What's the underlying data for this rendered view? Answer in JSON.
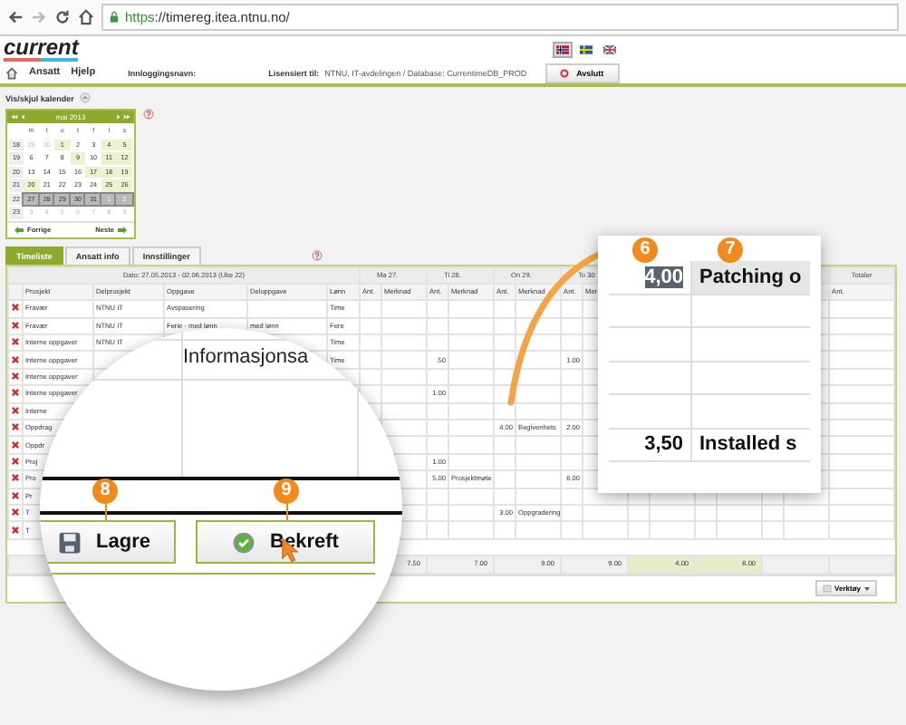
{
  "browser": {
    "url_scheme": "https",
    "url_rest": "://timereg.itea.ntnu.no/"
  },
  "logo": "current",
  "flags": [
    {
      "kind": "no",
      "selected": true
    },
    {
      "kind": "se",
      "selected": false
    },
    {
      "kind": "gb",
      "selected": false
    }
  ],
  "menu": {
    "items": [
      "Ansatt",
      "Hjelp"
    ],
    "login_label": "Innloggingsnavn:",
    "license_label": "Lisensiert til:",
    "license_value": "NTNU, IT-avdelingen / Database: CurrentimeDB_PROD",
    "logout": "Avslutt"
  },
  "calendar_toggle": "Vis/skjul kalender",
  "calendar": {
    "month": "mai 2013",
    "weekdays": [
      "m",
      "t",
      "o",
      "t",
      "f",
      "l",
      "s"
    ],
    "previous": "Forrige",
    "next": "Neste",
    "weeks": [
      {
        "week": "18",
        "selected": false,
        "days": [
          {
            "d": "29",
            "muted": true,
            "holiday": false
          },
          {
            "d": "30",
            "muted": true,
            "holiday": false
          },
          {
            "d": "1",
            "muted": false,
            "holiday": true
          },
          {
            "d": "2",
            "muted": false,
            "holiday": false
          },
          {
            "d": "3",
            "muted": false,
            "holiday": false
          },
          {
            "d": "4",
            "muted": false,
            "holiday": true
          },
          {
            "d": "5",
            "muted": false,
            "holiday": true
          }
        ]
      },
      {
        "week": "19",
        "selected": false,
        "days": [
          {
            "d": "6",
            "muted": false,
            "holiday": false
          },
          {
            "d": "7",
            "muted": false,
            "holiday": false
          },
          {
            "d": "8",
            "muted": false,
            "holiday": false
          },
          {
            "d": "9",
            "muted": false,
            "holiday": true
          },
          {
            "d": "10",
            "muted": false,
            "holiday": false
          },
          {
            "d": "11",
            "muted": false,
            "holiday": true
          },
          {
            "d": "12",
            "muted": false,
            "holiday": true
          }
        ]
      },
      {
        "week": "20",
        "selected": false,
        "days": [
          {
            "d": "13",
            "muted": false,
            "holiday": false
          },
          {
            "d": "14",
            "muted": false,
            "holiday": false
          },
          {
            "d": "15",
            "muted": false,
            "holiday": false
          },
          {
            "d": "16",
            "muted": false,
            "holiday": false
          },
          {
            "d": "17",
            "muted": false,
            "holiday": true
          },
          {
            "d": "18",
            "muted": false,
            "holiday": true
          },
          {
            "d": "19",
            "muted": false,
            "holiday": true
          }
        ]
      },
      {
        "week": "21",
        "selected": false,
        "days": [
          {
            "d": "20",
            "muted": false,
            "holiday": true
          },
          {
            "d": "21",
            "muted": false,
            "holiday": false
          },
          {
            "d": "22",
            "muted": false,
            "holiday": false
          },
          {
            "d": "23",
            "muted": false,
            "holiday": false
          },
          {
            "d": "24",
            "muted": false,
            "holiday": false
          },
          {
            "d": "25",
            "muted": false,
            "holiday": true
          },
          {
            "d": "26",
            "muted": false,
            "holiday": true
          }
        ]
      },
      {
        "week": "22",
        "selected": true,
        "days": [
          {
            "d": "27",
            "muted": false,
            "holiday": false
          },
          {
            "d": "28",
            "muted": false,
            "holiday": false
          },
          {
            "d": "29",
            "muted": false,
            "holiday": false
          },
          {
            "d": "30",
            "muted": false,
            "holiday": false
          },
          {
            "d": "31",
            "muted": false,
            "holiday": false
          },
          {
            "d": "1",
            "muted": true,
            "holiday": false
          },
          {
            "d": "2",
            "muted": true,
            "holiday": false
          }
        ]
      },
      {
        "week": "23",
        "selected": false,
        "days": [
          {
            "d": "3",
            "muted": true,
            "holiday": false
          },
          {
            "d": "4",
            "muted": true,
            "holiday": false
          },
          {
            "d": "5",
            "muted": true,
            "holiday": false
          },
          {
            "d": "6",
            "muted": true,
            "holiday": false
          },
          {
            "d": "7",
            "muted": true,
            "holiday": false
          },
          {
            "d": "8",
            "muted": true,
            "holiday": false
          },
          {
            "d": "9",
            "muted": true,
            "holiday": false
          }
        ]
      }
    ]
  },
  "tabs": [
    {
      "label": "Timeliste",
      "selected": true
    },
    {
      "label": "Ansatt info",
      "selected": false
    },
    {
      "label": "Innstillinger",
      "selected": false
    }
  ],
  "table": {
    "date_range": "Dato: 27.05.2013 - 02.06.2013 (Uke 22)",
    "columns": [
      "Prosjekt",
      "Delprosjekt",
      "Oppgave",
      "Deloppgave",
      "Lønn"
    ],
    "days": [
      {
        "label": "Ma 27.",
        "amount_header": "Ant.",
        "note_header": "Merknad"
      },
      {
        "label": "Ti 28.",
        "amount_header": "Ant.",
        "note_header": "Merknad"
      },
      {
        "label": "On 29.",
        "amount_header": "Ant.",
        "note_header": "Merknad"
      },
      {
        "label": "To 30",
        "amount_header": "Ant.",
        "note_header": "Mer"
      }
    ],
    "totals_label": "Totaler",
    "totals_sub": "Ant.",
    "rows": [
      {
        "project": "Fravær",
        "subproject": "NTNU IT",
        "task": "Avspasering",
        "wage": "Time"
      },
      {
        "project": "Fravær",
        "subproject": "NTNU IT",
        "task": "Ferie - med lønn",
        "subtask": "med lønn",
        "wage": "Fere"
      },
      {
        "project": "Interne oppgaver",
        "subproject": "NTNU IT",
        "wage": "Time"
      },
      {
        "project": "Interne oppgaver",
        "wage": "Time",
        "ti_28": {
          "amount": ".50"
        },
        "to_30": {
          "amount": "1.00"
        }
      },
      {
        "project": "Interne oppgaver"
      },
      {
        "project": "Interne oppgaver",
        "ti_28": {
          "amount": "1.00"
        }
      },
      {
        "project": "Interne"
      },
      {
        "project": "Oppdrag",
        "on_29": {
          "amount": "4.00",
          "note": "Begivenhets"
        },
        "to_30": {
          "amount": "2.00"
        }
      },
      {
        "project": "Oppdr"
      },
      {
        "project": "Proj",
        "ti_28": {
          "amount": "1.00"
        }
      },
      {
        "project": "Pro",
        "ti_28": {
          "amount": "5.00",
          "note": "Prosjektmøte"
        },
        "to_30": {
          "amount": "6.00"
        }
      },
      {
        "project": "Pr"
      },
      {
        "project": "T",
        "on_29": {
          "amount": "3.00",
          "note": "Oppgradering"
        }
      },
      {
        "project": "T"
      }
    ],
    "totals": [
      {
        "value": "7.50",
        "highlight": false
      },
      {
        "value": "7.00",
        "highlight": false
      },
      {
        "value": "9.00",
        "highlight": false
      },
      {
        "value": "9.00",
        "highlight": false
      },
      {
        "value": "4.00",
        "highlight": true
      },
      {
        "value": "6.00",
        "highlight": true
      }
    ],
    "tools_button": "Verktøy"
  },
  "zoom_popup": {
    "badges": [
      "6",
      "7"
    ],
    "rows": [
      {
        "amount": "4,00",
        "text": "Patching o",
        "selected": true
      },
      {
        "selected": false
      },
      {
        "selected": false
      },
      {
        "selected": false
      },
      {
        "selected": false
      },
      {
        "amount": "3,50",
        "text": "Installed s",
        "selected": false
      }
    ]
  },
  "magnifier": {
    "field_text": "Informasjonsa",
    "badges": [
      "8",
      "9"
    ],
    "buttons": [
      {
        "kind": "save",
        "label": "Lagre"
      },
      {
        "kind": "confirm",
        "label": "Bekreft"
      }
    ]
  }
}
